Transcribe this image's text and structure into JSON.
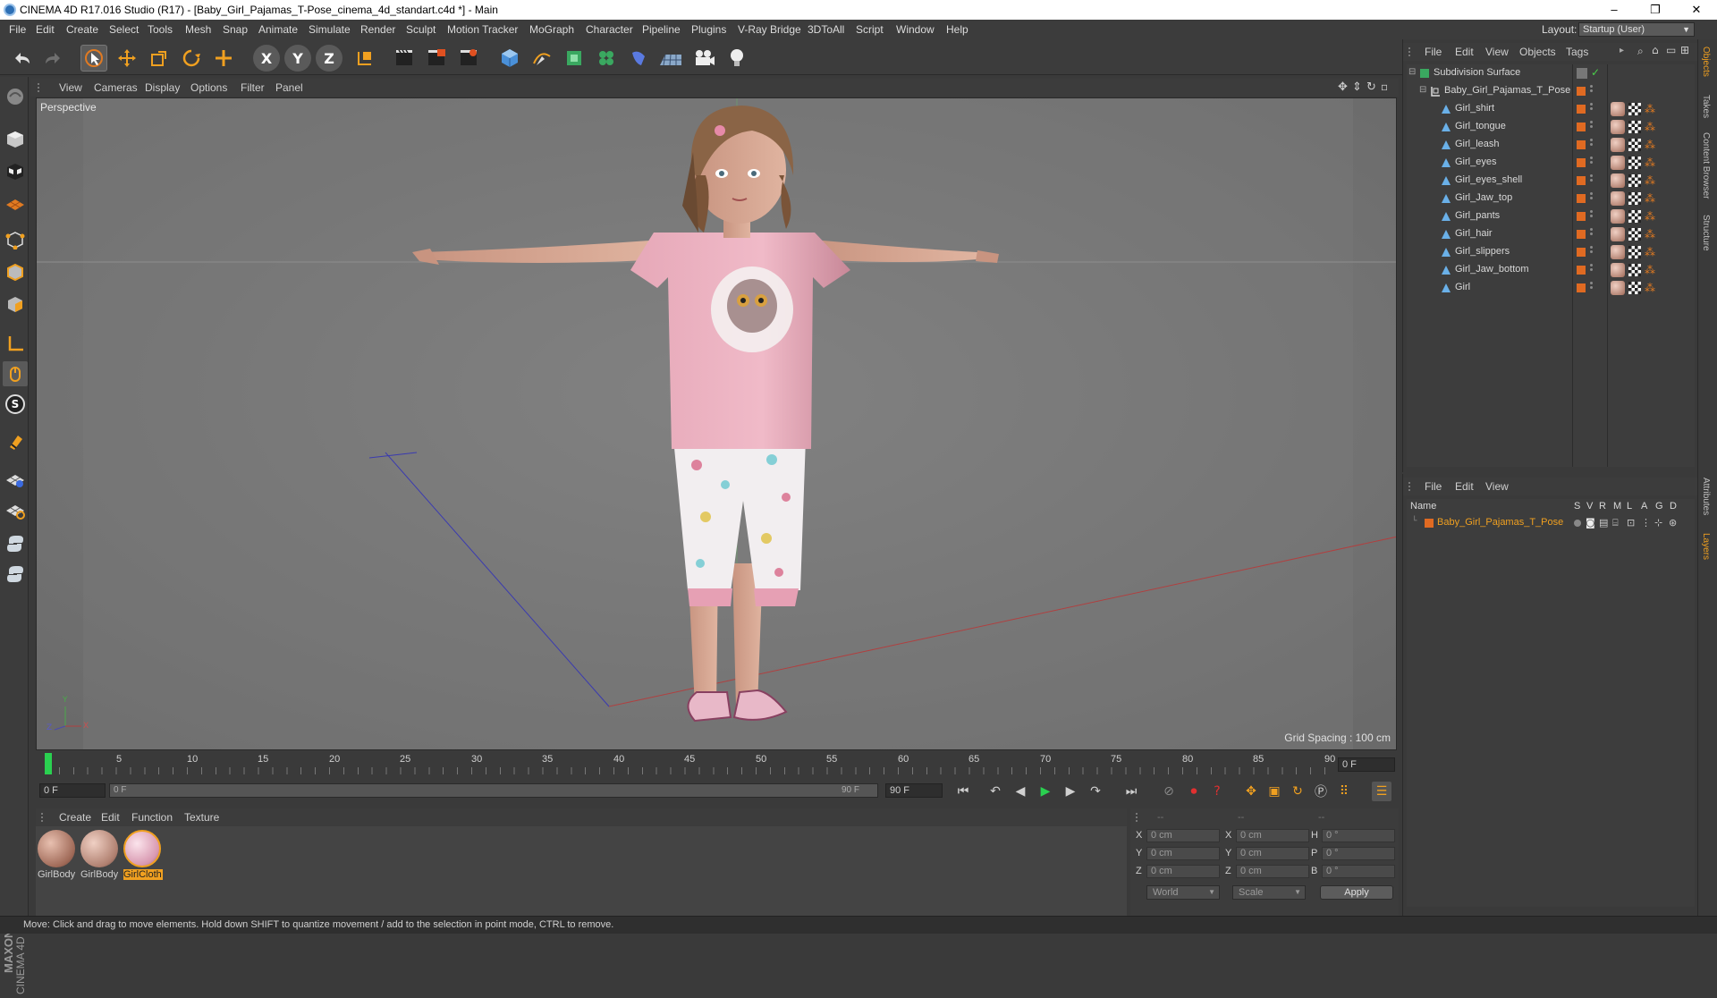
{
  "window": {
    "title": "CINEMA 4D R17.016 Studio (R17) - [Baby_Girl_Pajamas_T-Pose_cinema_4d_standart.c4d *] - Main",
    "controls": [
      "–",
      "❐",
      "✕"
    ]
  },
  "menubar": {
    "items": [
      "File",
      "Edit",
      "Create",
      "Select",
      "Tools",
      "Mesh",
      "Snap",
      "Animate",
      "Simulate",
      "Render",
      "Sculpt",
      "Motion Tracker",
      "MoGraph",
      "Character",
      "Pipeline",
      "Plugins",
      "V-Ray Bridge",
      "3DToAll",
      "Script",
      "Window",
      "Help"
    ],
    "layout_label": "Layout:",
    "layout_value": "Startup (User)"
  },
  "toolbar": {
    "icons": [
      "undo-icon",
      "redo-icon",
      "select-arrow-icon",
      "move-icon",
      "scale-icon",
      "rotate-icon",
      "add-icon",
      "x-axis-icon",
      "y-axis-icon",
      "z-axis-icon",
      "coordinate-system-icon",
      "render-view-icon",
      "render-picture-viewer-icon",
      "render-settings-icon",
      "cube-icon",
      "pen-spline-icon",
      "subdivision-icon",
      "mograph-cloner-icon",
      "deformer-icon",
      "floor-grid-icon",
      "camera-icon",
      "light-icon"
    ],
    "axis_labels": [
      "X",
      "Y",
      "Z"
    ]
  },
  "leftbar": {
    "icons": [
      "make-editable-icon",
      "model-mode-icon",
      "texture-mode-icon",
      "workplane-icon",
      "points-mode-icon",
      "edges-mode-icon",
      "polygons-mode-icon",
      "axis-mode-icon",
      "tweak-mode-icon",
      "solo-icon",
      "magnet-icon",
      "snap-grid-icon",
      "snap-settings-icon",
      "python-icon",
      "python-console-icon"
    ],
    "solo_letter": "S",
    "brand_line1": "MAXON",
    "brand_line2": "CINEMA 4D"
  },
  "viewport": {
    "menu": [
      "View",
      "Cameras",
      "Display",
      "Options",
      "Filter",
      "Panel"
    ],
    "label": "Perspective",
    "grid_spacing": "Grid Spacing : 100 cm",
    "axis_y": "Y",
    "axis_z": "Z",
    "axis_x": "X"
  },
  "timeline": {
    "ticks": [
      "0",
      "5",
      "10",
      "15",
      "20",
      "25",
      "30",
      "35",
      "40",
      "45",
      "50",
      "55",
      "60",
      "65",
      "70",
      "75",
      "80",
      "85",
      "90"
    ],
    "current_frame_field": "0 F",
    "start_field": "0 F",
    "range_start": "0 F",
    "range_end": "90 F",
    "end_field": "90 F"
  },
  "materials": {
    "menu": [
      "Create",
      "Edit",
      "Function",
      "Texture"
    ],
    "items": [
      {
        "name": "GirlBody",
        "color": "#b88070"
      },
      {
        "name": "GirlBody",
        "color": "#c89080"
      },
      {
        "name": "GirlCloth",
        "color": "#e8b8c8",
        "selected": true
      }
    ]
  },
  "coordinates": {
    "header": [
      "--",
      "--",
      "--"
    ],
    "rows": [
      {
        "a": "X",
        "av": "0 cm",
        "b": "X",
        "bv": "0 cm",
        "c": "H",
        "cv": "0 °"
      },
      {
        "a": "Y",
        "av": "0 cm",
        "b": "Y",
        "bv": "0 cm",
        "c": "P",
        "cv": "0 °"
      },
      {
        "a": "Z",
        "av": "0 cm",
        "b": "Z",
        "bv": "0 cm",
        "c": "B",
        "cv": "0 °"
      }
    ],
    "mode": "World",
    "transform": "Scale",
    "apply": "Apply"
  },
  "status": "Move: Click and drag to move elements. Hold down SHIFT to quantize movement / add to the selection in point mode, CTRL to remove.",
  "object_manager": {
    "menu": [
      "File",
      "Edit",
      "View",
      "Objects",
      "Tags"
    ],
    "objects": [
      {
        "name": "Subdivision Surface",
        "level": 0,
        "kind": "subdiv"
      },
      {
        "name": "Baby_Girl_Pajamas_T_Pose",
        "level": 1,
        "kind": "null"
      },
      {
        "name": "Girl_shirt",
        "level": 2,
        "kind": "mesh"
      },
      {
        "name": "Girl_tongue",
        "level": 2,
        "kind": "mesh"
      },
      {
        "name": "Girl_leash",
        "level": 2,
        "kind": "mesh"
      },
      {
        "name": "Girl_eyes",
        "level": 2,
        "kind": "mesh"
      },
      {
        "name": "Girl_eyes_shell",
        "level": 2,
        "kind": "mesh"
      },
      {
        "name": "Girl_Jaw_top",
        "level": 2,
        "kind": "mesh"
      },
      {
        "name": "Girl_pants",
        "level": 2,
        "kind": "mesh"
      },
      {
        "name": "Girl_hair",
        "level": 2,
        "kind": "mesh"
      },
      {
        "name": "Girl_slippers",
        "level": 2,
        "kind": "mesh"
      },
      {
        "name": "Girl_Jaw_bottom",
        "level": 2,
        "kind": "mesh"
      },
      {
        "name": "Girl",
        "level": 2,
        "kind": "mesh"
      }
    ]
  },
  "layer_manager": {
    "menu": [
      "File",
      "Edit",
      "View"
    ],
    "columns": [
      "Name",
      "S",
      "V",
      "R",
      "M",
      "L",
      "A",
      "G",
      "D"
    ],
    "layer_name": "Baby_Girl_Pajamas_T_Pose"
  },
  "right_tabs": [
    "Objects",
    "Takes",
    "Content Browser",
    "Structure",
    "Attributes",
    "Layers"
  ],
  "colors": {
    "accent_orange": "#e06a22",
    "selected_orange": "#f0a020",
    "viewport_bg": "#7a7a7a",
    "panel_bg": "#3a3a3a"
  }
}
